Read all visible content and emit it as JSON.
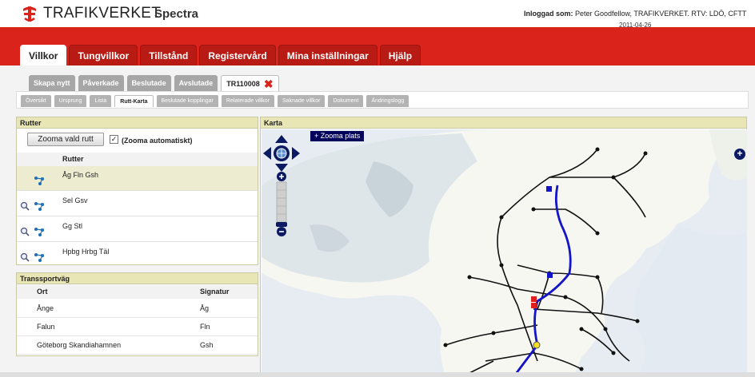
{
  "header": {
    "brand": "TRAFIKVERKET",
    "app_name": "Spectra",
    "login_label": "Inloggad som:",
    "login_user": "Peter Goodfellow, TRAFIKVERKET. RTV: LDÖ, CFTT",
    "date": "2011-04-26"
  },
  "main_tabs": [
    "Villkor",
    "Tungvillkor",
    "Tillstånd",
    "Registervård",
    "Mina inställningar",
    "Hjälp"
  ],
  "sub_tabs": [
    "Skapa nytt",
    "Påverkade",
    "Beslutade",
    "Avslutade",
    "TR110008"
  ],
  "detail_tabs": [
    "Översikt",
    "Ursprung",
    "Lista",
    "Rutt-Karta",
    "Beslutade kopplingar",
    "Relaterade villkor",
    "Saknade villkor",
    "Dokument",
    "Ändringslogg"
  ],
  "rutter_panel": {
    "title": "Rutter",
    "zoom_button": "Zooma vald rutt",
    "auto_zoom_label": "(Zooma automatiskt)",
    "auto_zoom_checked": true,
    "column_header": "Rutter",
    "routes": [
      {
        "name": "Åg Fln Gsh",
        "selected": true
      },
      {
        "name": "Sel Gsv",
        "selected": false
      },
      {
        "name": "Gg Stl",
        "selected": false
      },
      {
        "name": "Hpbg Hrbg Täl",
        "selected": false
      }
    ]
  },
  "transport_panel": {
    "title": "Transsportväg",
    "columns": [
      "Ort",
      "Signatur"
    ],
    "rows": [
      [
        "Ånge",
        "Åg"
      ],
      [
        "Falun",
        "Fln"
      ],
      [
        "Göteborg Skandiahamnen",
        "Gsh"
      ]
    ]
  },
  "map_panel": {
    "title": "Karta",
    "zoom_place_label": "+ Zooma plats"
  },
  "colors": {
    "brand_red": "#d9231b",
    "panel_header": "#e9e6b6",
    "route_blue": "#1414c8",
    "sea": "#e8edf2"
  },
  "icons": [
    "pan-control-icon",
    "zoom-in-icon",
    "zoom-out-icon",
    "magnifier-icon",
    "route-network-icon",
    "close-icon",
    "expand-plus-icon"
  ]
}
